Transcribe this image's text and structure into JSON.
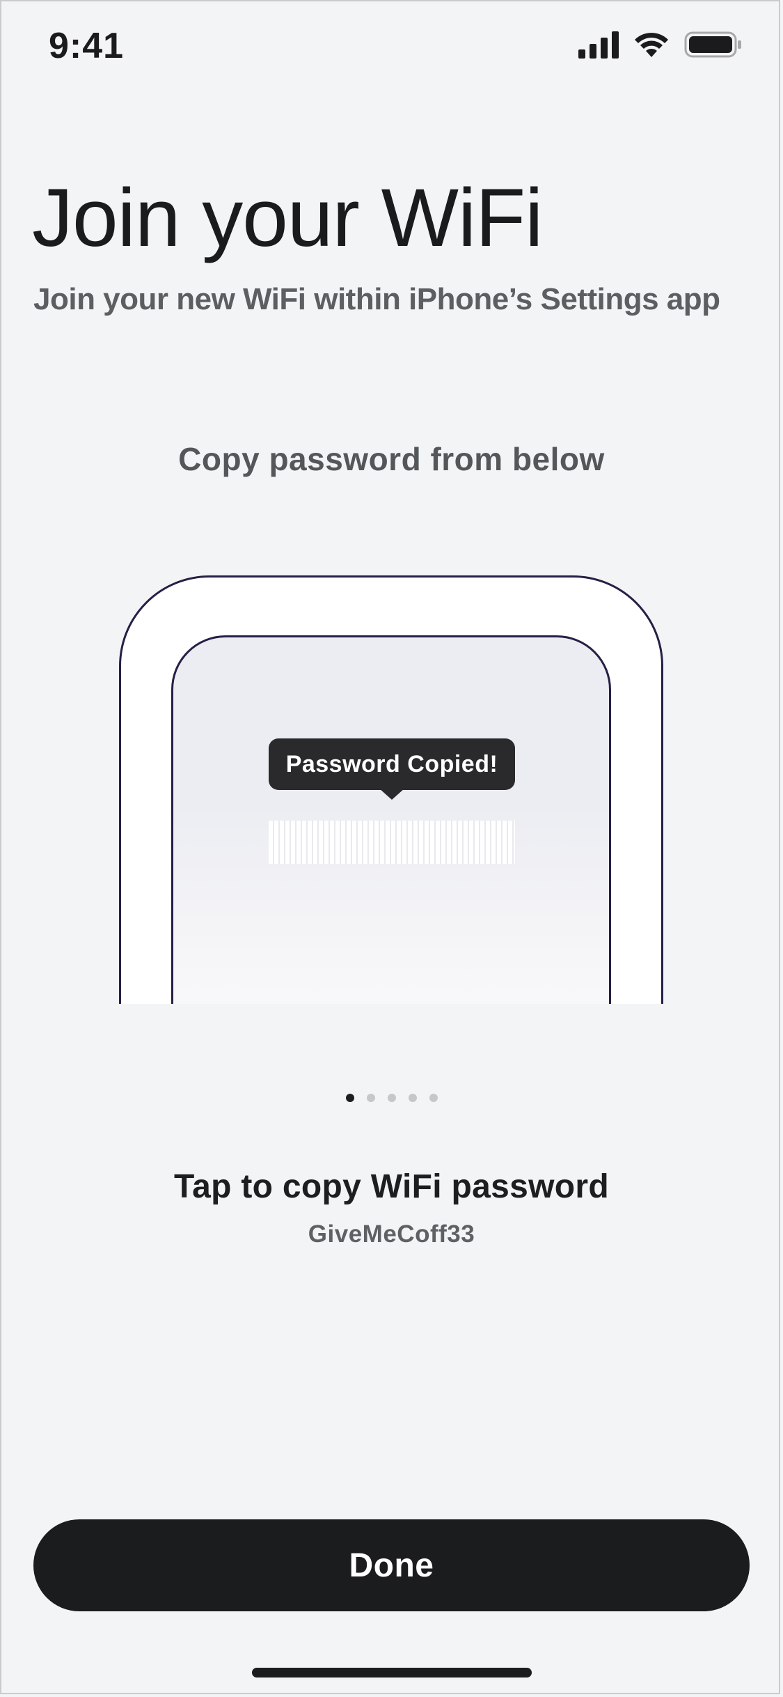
{
  "status_bar": {
    "time": "9:41",
    "icons": [
      "cellular-signal-icon",
      "wifi-icon",
      "battery-icon"
    ]
  },
  "header": {
    "title": "Join your WiFi",
    "subtitle": "Join your new WiFi within iPhone’s Settings app"
  },
  "step": {
    "heading": "Copy password from below",
    "tooltip": "Password Copied!",
    "caption": "Tap to copy WiFi password",
    "password": "GiveMeCoff33"
  },
  "pager": {
    "total": 5,
    "active_index": 0
  },
  "actions": {
    "done_label": "Done"
  },
  "colors": {
    "background": "#f3f4f6",
    "primary": "#1b1c1e",
    "illustration_outline": "#271f45",
    "muted_text": "#5c5f62"
  }
}
